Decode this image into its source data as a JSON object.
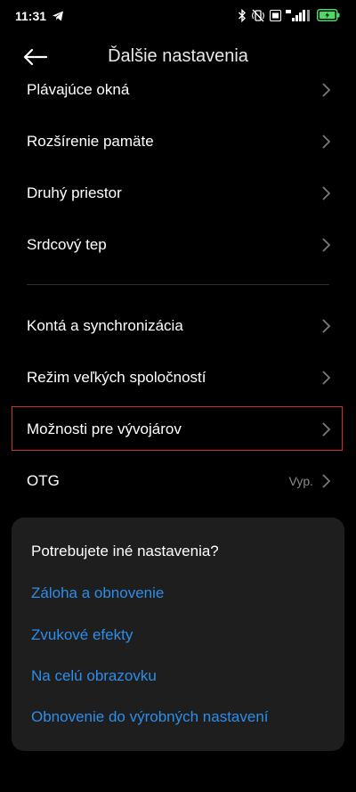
{
  "status_bar": {
    "time": "11:31",
    "battery_level": 0.8,
    "accent": "#4cd964"
  },
  "header": {
    "title": "Ďalšie nastavenia"
  },
  "settings": [
    {
      "label": "Plávajúce okná",
      "value": ""
    },
    {
      "label": "Rozšírenie pamäte",
      "value": ""
    },
    {
      "label": "Druhý priestor",
      "value": ""
    },
    {
      "label": "Srdcový tep",
      "value": ""
    },
    {
      "label": "Kontá a synchronizácia",
      "value": ""
    },
    {
      "label": "Režim veľkých spoločností",
      "value": ""
    },
    {
      "label": "Možnosti pre vývojárov",
      "value": ""
    },
    {
      "label": "OTG",
      "value": "Vyp."
    }
  ],
  "suggestions": {
    "title": "Potrebujete iné nastavenia?",
    "links": [
      "Záloha a obnovenie",
      "Zvukové efekty",
      "Na celú obrazovku",
      "Obnovenie do výrobných nastavení"
    ]
  },
  "colors": {
    "link": "#2d8eea",
    "highlight_border": "#d32a2a",
    "card_background": "#1e1e1e"
  }
}
